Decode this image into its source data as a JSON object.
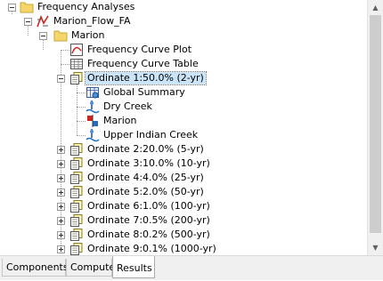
{
  "tree": {
    "root_label": "Frequency Analyses",
    "analysis_label": "Marion_Flow_FA",
    "group_label": "Marion",
    "plot_label": "Frequency Curve Plot",
    "table_label": "Frequency Curve Table",
    "selected_ordinate": "Ordinate 1:50.0% (2-yr)",
    "ordinate_children": [
      "Global Summary",
      "Dry Creek",
      "Marion",
      "Upper Indian Creek"
    ],
    "ordinates": [
      "Ordinate 2:20.0% (5-yr)",
      "Ordinate 3:10.0% (10-yr)",
      "Ordinate 4:4.0% (25-yr)",
      "Ordinate 5:2.0% (50-yr)",
      "Ordinate 6:1.0% (100-yr)",
      "Ordinate 7:0.5% (200-yr)",
      "Ordinate 8:0.2% (500-yr)",
      "Ordinate 9:0.1% (1000-yr)"
    ]
  },
  "scrollbar": {
    "up_glyph": "▲",
    "down_glyph": "▼"
  },
  "tabs": [
    "Components",
    "Compute",
    "Results"
  ],
  "active_tab": "Results",
  "colors": {
    "selection": "#cce4f7",
    "folder": "#f5d66b",
    "accent": "#c8261e"
  }
}
